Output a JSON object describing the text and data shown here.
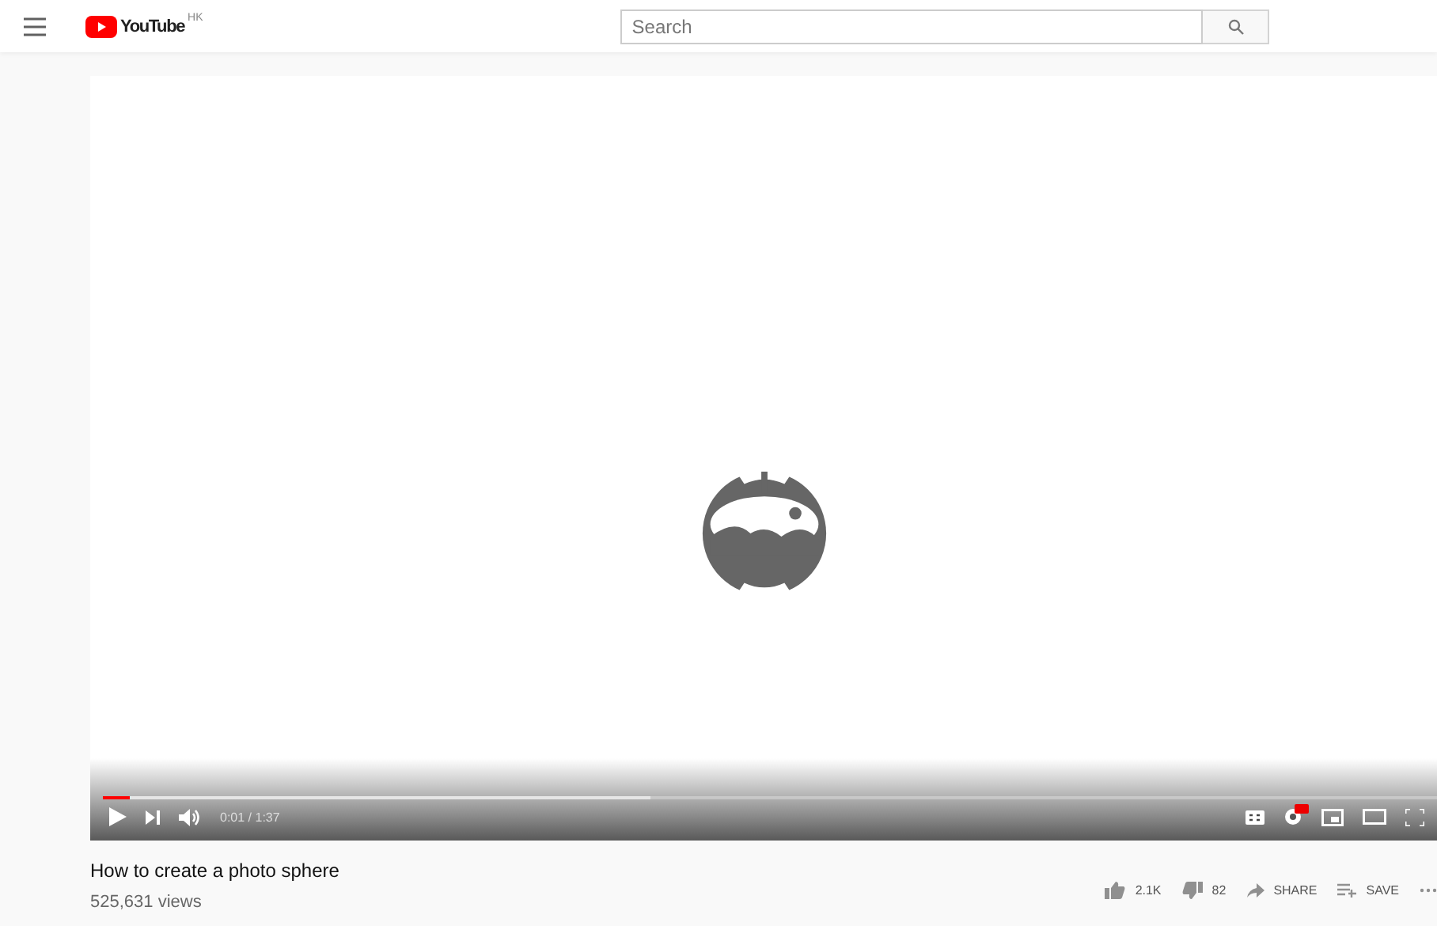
{
  "header": {
    "logo_text": "YouTube",
    "logo_region": "HK",
    "search": {
      "placeholder": "Search"
    }
  },
  "player": {
    "kind": "picture",
    "progress": {
      "level": 0.02
    },
    "buffer": {
      "level": 0.41
    },
    "time": "0:01 / 1:37",
    "hd": true
  },
  "video": {
    "title": "How to create a photo sphere",
    "views": "525,631 views"
  },
  "actions": [
    {
      "kind": "like",
      "label": "2.1K"
    },
    {
      "kind": "dislike",
      "label": "82"
    },
    {
      "kind": "share",
      "label": "SHARE"
    },
    {
      "kind": "save",
      "label": "SAVE"
    },
    {
      "kind": "more"
    }
  ]
}
